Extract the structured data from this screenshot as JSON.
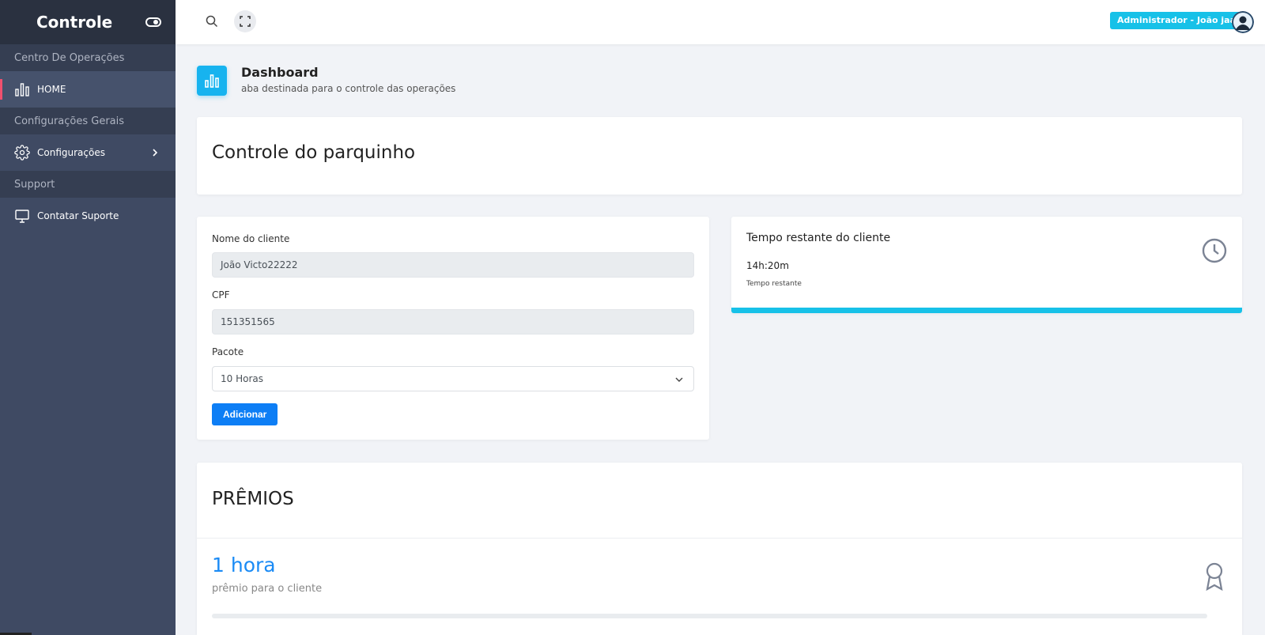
{
  "sidebar": {
    "brand": "Controle",
    "sections": [
      {
        "title": "Centro De Operações",
        "items": [
          {
            "label": "HOME",
            "icon": "bar-chart-icon"
          }
        ]
      },
      {
        "title": "Configurações Gerais",
        "items": [
          {
            "label": "Configurações",
            "icon": "gear-icon"
          }
        ]
      },
      {
        "title": "Support",
        "items": [
          {
            "label": "Contatar Suporte",
            "icon": "monitor-icon"
          }
        ]
      }
    ]
  },
  "topbar": {
    "user_badge": "Administrador - João jaaj"
  },
  "page_header": {
    "title": "Dashboard",
    "subtitle": "aba destinada para o controle das operações"
  },
  "control_card": {
    "title": "Controle do parquinho"
  },
  "form": {
    "name_label": "Nome do cliente",
    "name_value": "João Victo22222",
    "cpf_label": "CPF",
    "cpf_value": "151351565",
    "package_label": "Pacote",
    "package_value": "10 Horas",
    "add_button": "Adicionar"
  },
  "time_card": {
    "title": "Tempo restante do cliente",
    "value": "14h:20m",
    "caption": "Tempo restante"
  },
  "prizes": {
    "title": "PRÊMIOS",
    "value": "1 hora",
    "caption": "prêmio para o cliente",
    "progress": 0
  },
  "colors": {
    "accent": "#17c1e8",
    "primary": "#0d7ef5",
    "sidebar": "#3f4a63",
    "active_marker": "#f0506e"
  }
}
